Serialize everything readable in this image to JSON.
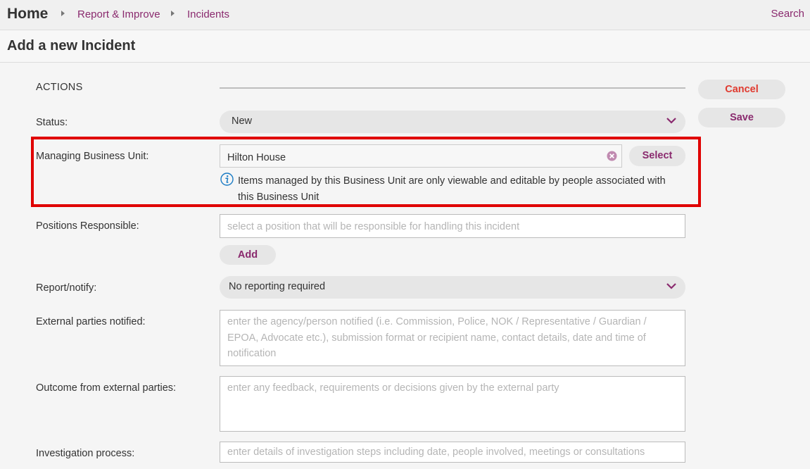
{
  "breadcrumb": {
    "home": "Home",
    "items": [
      "Report & Improve",
      "Incidents"
    ],
    "search": "Search"
  },
  "page": {
    "title": "Add a new Incident"
  },
  "actions": {
    "section": "ACTIONS",
    "cancel": "Cancel",
    "save": "Save"
  },
  "form": {
    "status": {
      "label": "Status:",
      "value": "New"
    },
    "business_unit": {
      "label": "Managing Business Unit:",
      "value": "Hilton House",
      "select_button": "Select",
      "info": "Items managed by this Business Unit are only viewable and editable by people associated with this Business Unit"
    },
    "positions": {
      "label": "Positions Responsible:",
      "placeholder": "select a position that will be responsible for handling this incident",
      "add_button": "Add"
    },
    "report_notify": {
      "label": "Report/notify:",
      "value": "No reporting required"
    },
    "external_parties": {
      "label": "External parties notified:",
      "placeholder": "enter the agency/person notified (i.e. Commission, Police, NOK / Representative / Guardian / EPOA, Advocate etc.), submission format or recipient name, contact details, date and time of notification"
    },
    "outcome": {
      "label": "Outcome from external parties:",
      "placeholder": "enter any feedback, requirements or decisions given by the external party"
    },
    "investigation": {
      "label": "Investigation process:",
      "placeholder": "enter details of investigation steps including date, people involved, meetings or consultations"
    }
  },
  "colors": {
    "accent": "#8a2a6e",
    "cancel": "#e03a2f",
    "highlight": "#e00000",
    "info_icon": "#1a7bc4"
  },
  "icons": [
    "chevron-down-icon",
    "clear-icon",
    "info-icon",
    "caret-right-icon"
  ]
}
